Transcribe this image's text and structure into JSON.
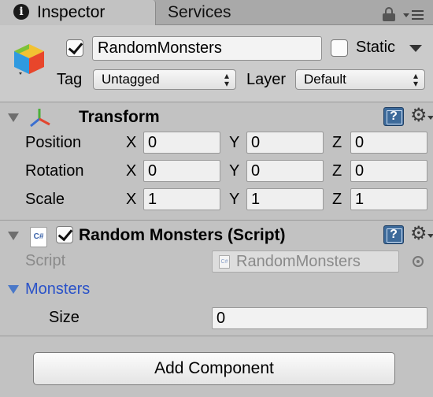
{
  "tabs": [
    {
      "label": "Inspector",
      "icon": "info-icon",
      "active": true
    },
    {
      "label": "Services",
      "active": false
    }
  ],
  "header": {
    "object_icon": "cube-icon",
    "active": true,
    "name": "RandomMonsters",
    "static_label": "Static",
    "static_checked": false,
    "tag_label": "Tag",
    "tag_value": "Untagged",
    "layer_label": "Layer",
    "layer_value": "Default"
  },
  "transform": {
    "title": "Transform",
    "rows": [
      {
        "label": "Position",
        "x": "0",
        "y": "0",
        "z": "0"
      },
      {
        "label": "Rotation",
        "x": "0",
        "y": "0",
        "z": "0"
      },
      {
        "label": "Scale",
        "x": "1",
        "y": "1",
        "z": "1"
      }
    ],
    "axes": [
      "X",
      "Y",
      "Z"
    ]
  },
  "script_component": {
    "title": "Random Monsters (Script)",
    "enabled": true,
    "file_icon_text": "C#",
    "script_label": "Script",
    "script_value": "RandomMonsters",
    "monsters_label": "Monsters",
    "size_label": "Size",
    "size_value": "0"
  },
  "add_component_label": "Add Component",
  "colors": {
    "background": "#c2c2c2",
    "link_blue": "#2a52c8",
    "help_blue": "#3d6a9a"
  }
}
